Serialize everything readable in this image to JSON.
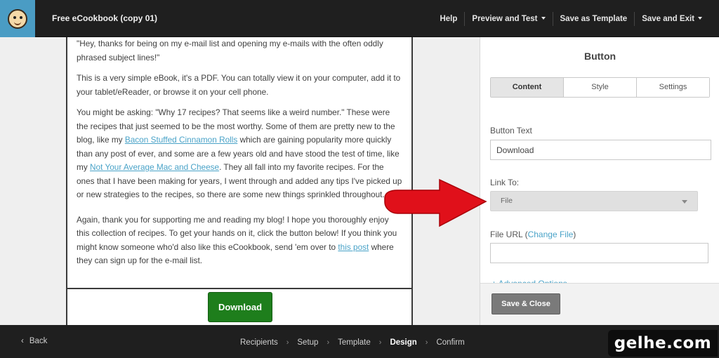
{
  "app": {
    "title": "Free eCookbook (copy 01)",
    "logo_icon": "mailchimp-logo-icon"
  },
  "topnav": [
    {
      "label": "Help",
      "dropdown": false
    },
    {
      "label": "Preview and Test",
      "dropdown": true
    },
    {
      "label": "Save as Template",
      "dropdown": false
    },
    {
      "label": "Save and Exit",
      "dropdown": true
    }
  ],
  "content": {
    "p0": "\"Hey, thanks for being on my e-mail list and opening my e-mails with the often oddly phrased subject lines!\"",
    "p1": "This is a very simple eBook, it's a PDF. You can totally view it on your computer, add it to your tablet/eReader, or browse it on your cell phone.",
    "p2_a": "You might be asking: \"Why 17 recipes? That seems like a weird number.\" These were the recipes that just seemed to be the most worthy. Some of them are pretty new to the blog, like my ",
    "p2_link1": "Bacon Stuffed Cinnamon Rolls",
    "p2_b": " which are gaining popularity more quickly than any post of ever, and some are a few years old and have stood the test of time, like my ",
    "p2_link2": "Not Your Average Mac and Cheese",
    "p2_c": ". They all fall into my favorite recipes. For the ones that I have been making for years, I went through and added any tips I've picked up or new strategies to the recipes, so there are some new things sprinkled throughout.",
    "p3_a": "Again, thank you for supporting me and reading my blog! I hope you thoroughly enjoy this collection of recipes. To get your hands on it, click the button below! If you think you might know someone who'd also like this eCookbook, send 'em over to ",
    "p3_link": "this post",
    "p3_b": " where they can sign up for the e-mail list.",
    "download_button": "Download"
  },
  "panel": {
    "title": "Button",
    "tabs": [
      {
        "label": "Content",
        "active": true
      },
      {
        "label": "Style",
        "active": false
      },
      {
        "label": "Settings",
        "active": false
      }
    ],
    "button_text_label": "Button Text",
    "button_text_value": "Download",
    "link_to_label": "Link To:",
    "link_to_value": "File",
    "file_url_label": "File URL",
    "change_file_link": "Change File",
    "file_url_value": "",
    "advanced_options": "+ Advanced Options",
    "save_close": "Save & Close"
  },
  "bottombar": {
    "back": "Back",
    "steps": [
      {
        "label": "Recipients",
        "active": false
      },
      {
        "label": "Setup",
        "active": false
      },
      {
        "label": "Template",
        "active": false
      },
      {
        "label": "Design",
        "active": true
      },
      {
        "label": "Confirm",
        "active": false
      }
    ]
  },
  "watermark": "gelhe.com",
  "colors": {
    "topbar": "#1f1f1f",
    "logo_bg": "#4a9cc4",
    "link": "#4aa3c8",
    "download_button": "#1e7e1c",
    "arrow": "#e0101a"
  }
}
